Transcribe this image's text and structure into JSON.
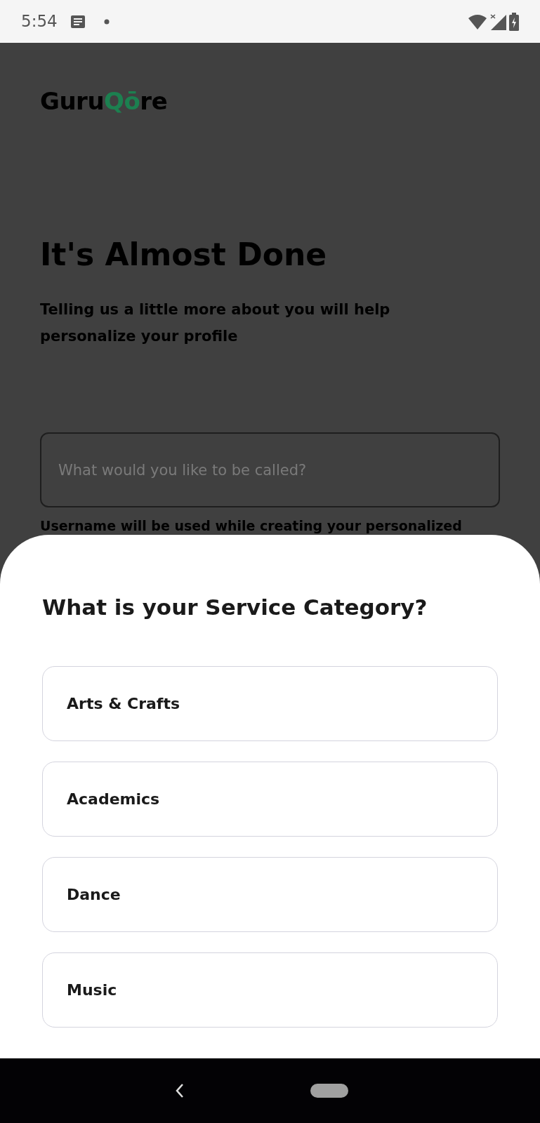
{
  "status_bar": {
    "time": "5:54"
  },
  "logo": [
    {
      "text": "Guru",
      "accent": false
    },
    {
      "text": "Qō",
      "accent": true
    },
    {
      "text": "re",
      "accent": false
    }
  ],
  "heading": "It's Almost Done",
  "subtitle": "Telling us a little more about you will help personalize your profile",
  "username_field": {
    "placeholder": "What would you like to be called?"
  },
  "helper_text": "Username will be used while creating your personalized",
  "sheet": {
    "title": "What is your Service Category?",
    "options": [
      {
        "label": "Arts & Crafts"
      },
      {
        "label": "Academics"
      },
      {
        "label": "Dance"
      },
      {
        "label": "Music"
      }
    ]
  }
}
